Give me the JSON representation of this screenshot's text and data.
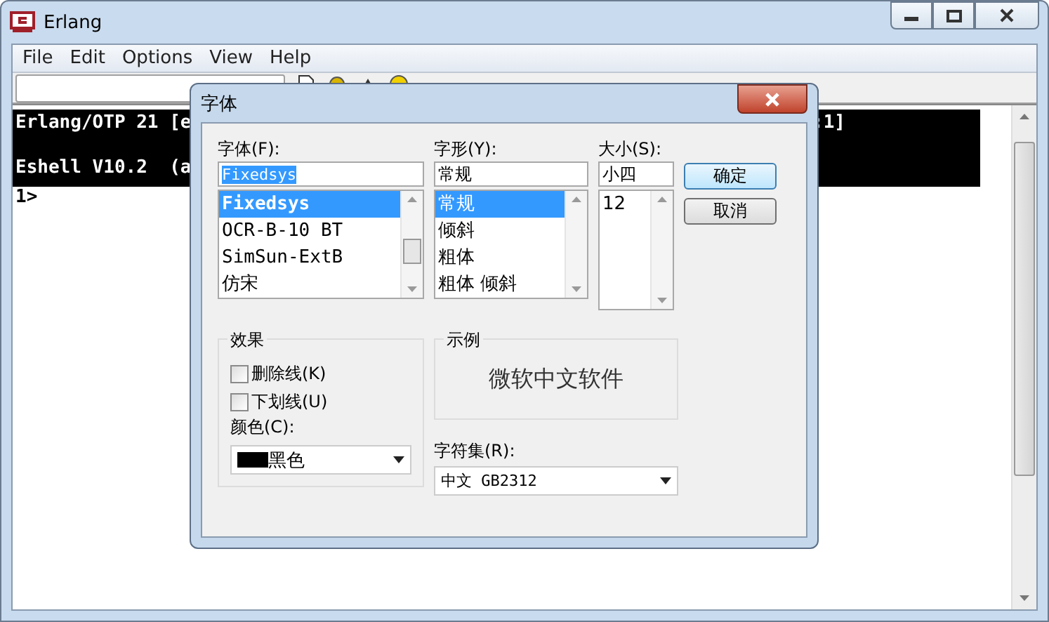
{
  "window": {
    "title": "Erlang"
  },
  "menu": [
    {
      "label": "File"
    },
    {
      "label": "Edit"
    },
    {
      "label": "Options"
    },
    {
      "label": "View"
    },
    {
      "label": "Help"
    }
  ],
  "console": {
    "banner": [
      {
        "text": "Erlang/OTP 21 [e",
        "tail": ":1]"
      },
      {
        "text": "Eshell V10.2  (a"
      }
    ],
    "prompt": "1>"
  },
  "font_dialog": {
    "title": "字体",
    "font": {
      "label": "字体(F):",
      "value": "Fixedsys",
      "value_selected": true,
      "items": [
        {
          "label": "Fixedsys",
          "selected": true
        },
        {
          "label": "OCR-B-10 BT",
          "selected": false
        },
        {
          "label": "SimSun-ExtB",
          "selected": false
        },
        {
          "label": "仿宋",
          "selected": false
        }
      ]
    },
    "style": {
      "label": "字形(Y):",
      "value": "常规",
      "items": [
        {
          "label": "常规",
          "selected": true
        },
        {
          "label": "倾斜",
          "selected": false
        },
        {
          "label": "粗体",
          "selected": false
        },
        {
          "label": "粗体 倾斜",
          "selected": false
        }
      ]
    },
    "size": {
      "label": "大小(S):",
      "value": "小四",
      "items": [
        {
          "label": "12",
          "selected": false
        }
      ]
    },
    "buttons": [
      {
        "label": "确定",
        "default": true
      },
      {
        "label": "取消",
        "default": false
      }
    ],
    "effects": {
      "title": "效果",
      "options": [
        {
          "label": "删除线(K)",
          "checked": false
        },
        {
          "label": "下划线(U)",
          "checked": false
        }
      ],
      "color_label": "颜色(C):",
      "color": {
        "label": "黑色",
        "color": "#000000"
      }
    },
    "sample": {
      "title": "示例",
      "text": "微软中文软件"
    },
    "charset": {
      "label": "字符集(R):",
      "value": "中文 GB2312"
    }
  }
}
